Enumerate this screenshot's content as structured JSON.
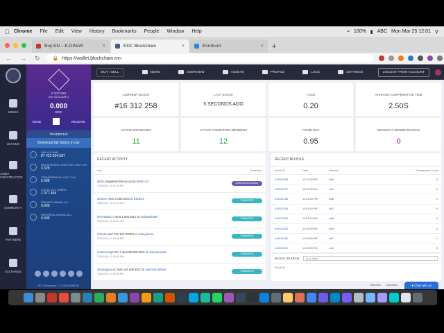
{
  "os_menu": {
    "items": [
      "Chrome",
      "File",
      "Edit",
      "View",
      "History",
      "Bookmarks",
      "People",
      "Window",
      "Help"
    ],
    "battery": "100%",
    "input_source": "ABC",
    "datetime": "Mon Mar 25  12:01"
  },
  "browser": {
    "tabs": [
      {
        "label": "Buy EN – E-DINAR",
        "fav_color": "#c0392b"
      },
      {
        "label": "EDC Blockchain",
        "fav_color": "#4a5a8a"
      },
      {
        "label": "Ecrofund",
        "fav_color": "#2e86de"
      }
    ],
    "url": "https://wallet.blockchain.mn"
  },
  "sidenav": {
    "items": [
      "MINING",
      "LEASING",
      "ASSET CONSTRUCTOR",
      "COMMUNITY",
      "PARTNERS",
      "EXCHANGE"
    ]
  },
  "account": {
    "id_line1": "# 1077484",
    "id_line2": "(MY ACCOUNT)",
    "balance": "0.000",
    "currency": "EDC",
    "send": "SEND",
    "receive": "RECEIVE",
    "name": "TRADER123",
    "download": "Download full history in csv",
    "stats": [
      {
        "label": "24H VOLUME",
        "value": "87 422 654.587"
      },
      {
        "label": "REGISTERED USERS BY LAST 24H",
        "value": "3 329"
      },
      {
        "label": "TRANSFERS BY LAST 24H",
        "value": "5 699"
      },
      {
        "label": "COUNT ALL USERS",
        "value": "1 077 494"
      },
      {
        "label": "PRIVATE MINING ALL",
        "value": "0.000"
      },
      {
        "label": "REFERRAL MINING ALL",
        "value": "0.000"
      }
    ],
    "version": "EDC Blockchain 2.7.0.298          #1069106"
  },
  "topnav": {
    "buy_sell": "BUY / SELL",
    "links": [
      "NEWS",
      "OVERVIEW",
      "ASSETS",
      "PROFILE",
      "LOCK",
      "SETTINGS"
    ],
    "logout": "LOGOUT FROM ACCOUNT"
  },
  "cards": [
    {
      "label": "CURRENT BLOCK",
      "value": "#16 312 258",
      "color": "default"
    },
    {
      "label": "LAST BLOCK",
      "value": "5 SECONDS AGO",
      "color": "default"
    },
    {
      "label": "TXS/S",
      "value": "0.20",
      "color": "default"
    },
    {
      "label": "AVERAGE CONFIRMATION TIME",
      "value": "2.50S",
      "color": "default"
    },
    {
      "label": "ACTIVE WITNESSES",
      "value": "11",
      "color": "green"
    },
    {
      "label": "ACTIVE COMMITTEE MEMBERS",
      "value": "12",
      "color": "green"
    },
    {
      "label": "TXS/BLOCK",
      "value": "0.95",
      "color": "default"
    },
    {
      "label": "RECENTLY MISSED BLOCKS",
      "value": "0",
      "color": "purple"
    }
  ],
  "recent_activity": {
    "title": "RECENT ACTIVITY",
    "col_info": "Info",
    "col_op": "Operation",
    "rows": [
      {
        "actor": "alpha",
        "text": " registered the account ",
        "target": "trader123",
        "date": "3/25/2019, 12:01:30 PM",
        "op": "CREATE ACCOUNT",
        "op_color": "#6b57b5"
      },
      {
        "actor": "a415srs",
        "text": " sent 1.000 EDC to ",
        "target": "b415srs",
        "date": "3/25/2019, 12:01:15 PM",
        "op": "TRANSFER",
        "op_color": "#3bb3c3"
      },
      {
        "actor": "hermawan77",
        "text": " sent 1.000 EDC to ",
        "target": "widyaafna09",
        "date": "3/25/2019, 12:01:03 PM",
        "op": "TRANSFER",
        "op_color": "#3bb3c3"
      },
      {
        "actor": "rifat-85",
        "text": " sent 137.142 EDRG to ",
        "target": "nadi-jantore",
        "date": "3/25/2019, 12:00:48 PM",
        "op": "TRANSFER",
        "op_color": "#3bb3c3"
      },
      {
        "actor": "martinezdg1290-1",
        "text": " sent 90.000 EDC to ",
        "target": "milenamoda2",
        "date": "3/25/2019, 12:00:45 PM",
        "op": "TRANSFER",
        "op_color": "#3bb3c3"
      },
      {
        "actor": "semangat-edc",
        "text": " sent 145.000 EDC to ",
        "target": "tuah-edc-belitar",
        "date": "3/25/2019, 12:00:45 PM",
        "op": "TRANSFER",
        "op_color": "#3bb3c3"
      }
    ]
  },
  "recent_blocks": {
    "title": "RECENT BLOCKS",
    "cols": [
      "Block ID",
      "Date",
      "Witness",
      "Transaction count"
    ],
    "rows": [
      {
        "id": "#16312258",
        "date": "12:01:30 PM",
        "witness": "init0",
        "count": "0"
      },
      {
        "id": "#16312257",
        "date": "12:01:25 PM",
        "witness": "init1",
        "count": "1"
      },
      {
        "id": "#16312256",
        "date": "12:01:20 PM",
        "witness": "init8",
        "count": "1"
      },
      {
        "id": "#16312255",
        "date": "12:01:15 PM",
        "witness": "init2",
        "count": "0"
      },
      {
        "id": "#16312254",
        "date": "12:01:10 PM",
        "witness": "init8",
        "count": "0"
      },
      {
        "id": "#16312253",
        "date": "12:01:05 PM",
        "witness": "init3",
        "count": "2"
      },
      {
        "id": "#16312252",
        "date": "12:00:55 PM",
        "witness": "init7",
        "count": "1"
      },
      {
        "id": "#16312251",
        "date": "12:00:50 PM",
        "witness": "init0",
        "count": "0"
      }
    ],
    "search_title": "BLOCK SEARCH",
    "search_placeholder": "id or hash",
    "search_col": "Block ID"
  },
  "footer": {
    "overview": "Overview",
    "community": "Commun...",
    "chat": "Chat with us"
  }
}
